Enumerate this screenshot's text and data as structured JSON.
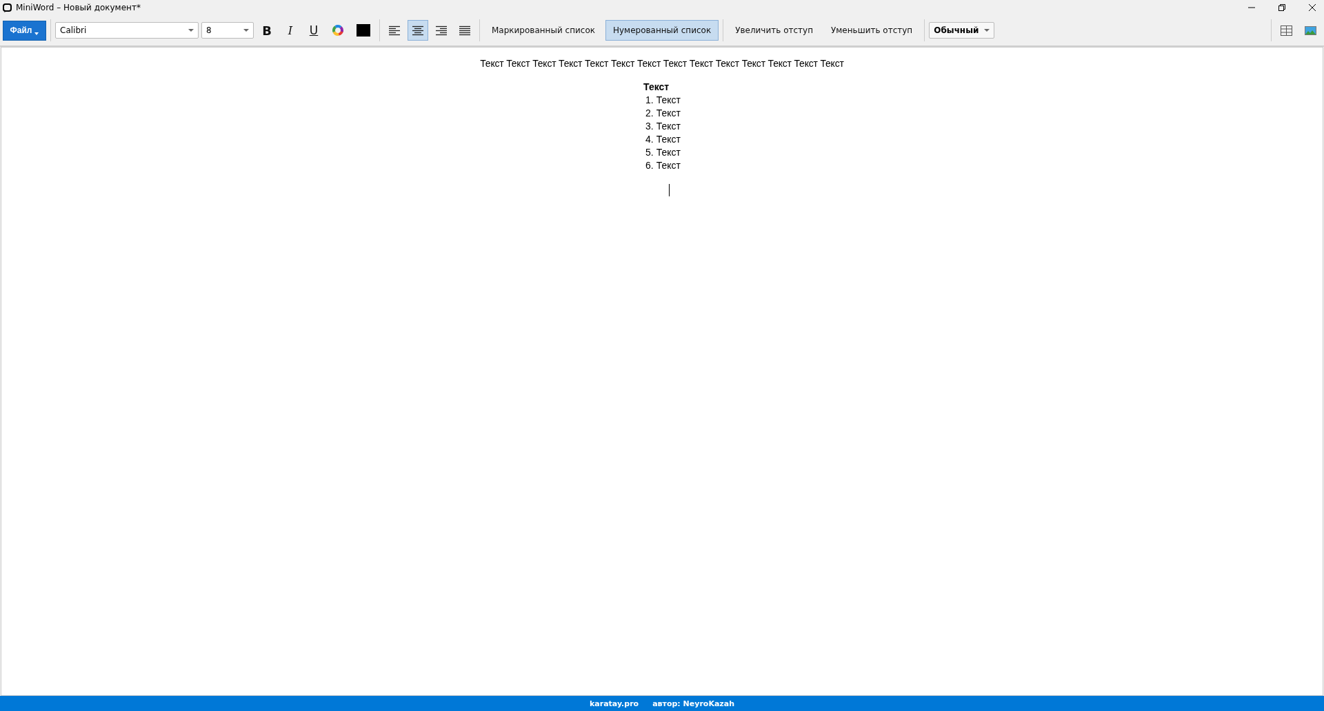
{
  "window": {
    "title": "MiniWord – Новый документ*"
  },
  "toolbar": {
    "file_button": "Файл",
    "font": {
      "value": "Calibri"
    },
    "size": {
      "value": "8"
    },
    "format_buttons": [
      {
        "kind": "bold",
        "label": "B",
        "selected": false
      },
      {
        "kind": "italic",
        "label": "I",
        "selected": false
      },
      {
        "kind": "underline",
        "label": "U",
        "selected": false
      }
    ],
    "align_buttons": [
      {
        "kind": "left",
        "selected": false
      },
      {
        "kind": "center",
        "selected": true
      },
      {
        "kind": "right",
        "selected": false
      },
      {
        "kind": "justify",
        "selected": false
      }
    ],
    "list_buttons": [
      {
        "label": "Маркированный список",
        "selected": false
      },
      {
        "label": "Нумерованный список",
        "selected": true
      }
    ],
    "indent_buttons": [
      "Увеличить отступ",
      "Уменьшить отступ"
    ],
    "style": {
      "value": "Обычный"
    }
  },
  "document": {
    "paragraph": "Текст Текст Текст Текст Текст Текст Текст Текст Текст Текст Текст Текст Текст Текст",
    "heading": "Текст",
    "list_items": [
      {
        "number": "1.",
        "text": "Текст"
      },
      {
        "number": "2.",
        "text": "Текст"
      },
      {
        "number": "3.",
        "text": "Текст"
      },
      {
        "number": "4.",
        "text": "Текст"
      },
      {
        "number": "5.",
        "text": "Текст"
      },
      {
        "number": "6.",
        "text": "Текст"
      }
    ]
  },
  "status_bar": {
    "site": "karatay.pro",
    "author": "автор: NeyroKazah"
  }
}
